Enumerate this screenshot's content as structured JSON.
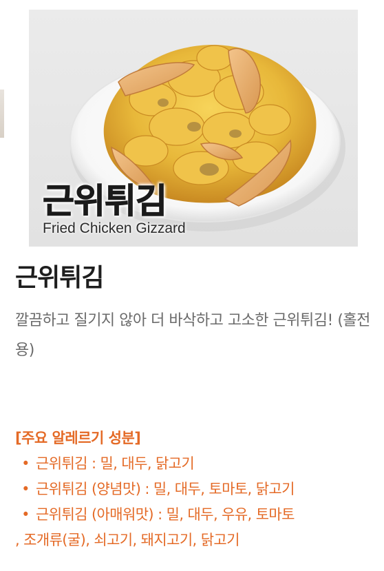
{
  "menu_item": {
    "image_overlay_ko": "근위튀김",
    "image_overlay_en": "Fried Chicken Gizzard",
    "name": "근위튀김",
    "description": "깔끔하고 질기지 않아 더 바삭하고 고소한 근위튀김! (홀전용)"
  },
  "allergy": {
    "heading": "[주요 알레르기 성분]",
    "items": [
      {
        "text": "근위튀김 : 밀, 대두, 닭고기",
        "continuation": ""
      },
      {
        "text": "근위튀김 (양념맛) : 밀, 대두, 토마토, 닭고기",
        "continuation": ""
      },
      {
        "text": "근위튀김 (아매워맛) : 밀, 대두, 우유, 토마토",
        "continuation": ", 조개류(굴), 쇠고기, 돼지고기, 닭고기"
      }
    ]
  },
  "colors": {
    "accent": "#e46a26",
    "title": "#1e1e1e",
    "body": "#6a6a6a"
  }
}
